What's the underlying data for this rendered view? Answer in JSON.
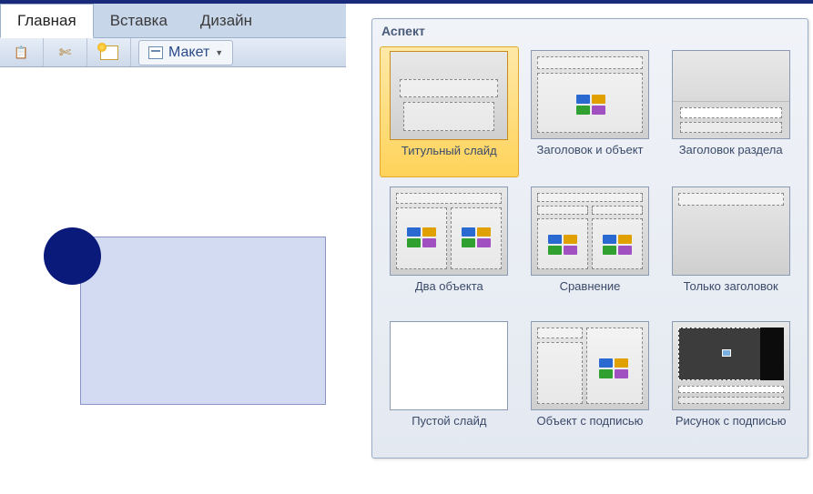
{
  "tabs": {
    "home": "Главная",
    "insert": "Вставка",
    "design": "Дизайн"
  },
  "toolbar": {
    "layout_label": "Макет"
  },
  "gallery": {
    "title": "Аспект",
    "layouts": [
      {
        "label": "Титульный слайд"
      },
      {
        "label": "Заголовок и объект"
      },
      {
        "label": "Заголовок раздела"
      },
      {
        "label": "Два объекта"
      },
      {
        "label": "Сравнение"
      },
      {
        "label": "Только заголовок"
      },
      {
        "label": "Пустой слайд"
      },
      {
        "label": "Объект с подписью"
      },
      {
        "label": "Рисунок с подписью"
      }
    ]
  }
}
